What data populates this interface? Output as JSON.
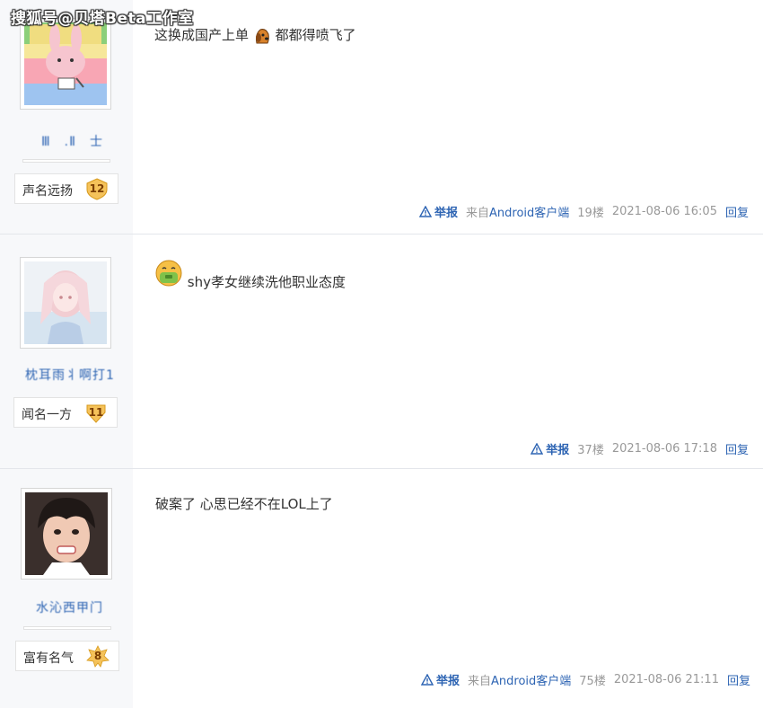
{
  "watermark": "搜狐号@贝塔Beta工作室",
  "posts": [
    {
      "username": "Ⅲ　.Ⅱ　士",
      "level_name": "声名远扬",
      "level_num": "12",
      "content_before": "这换成国产上单",
      "content_after": "都都得喷飞了",
      "report_label": "举报",
      "client_prefix": "来自",
      "client_name": "Android客户端",
      "floor": "19楼",
      "datetime": "2021-08-06 16:05",
      "reply_label": "回复"
    },
    {
      "username": "枕耳雨丬啊打1",
      "level_name": "闻名一方",
      "level_num": "11",
      "content_before": "",
      "content_after": "shy孝女继续洗他职业态度",
      "report_label": "举报",
      "floor": "37楼",
      "datetime": "2021-08-06 17:18",
      "reply_label": "回复"
    },
    {
      "username": "水沁西甲门",
      "level_name": "富有名气",
      "level_num": "8",
      "content_before": "",
      "content_after": "破案了 心思已经不在LOL上了",
      "report_label": "举报",
      "client_prefix": "来自",
      "client_name": "Android客户端",
      "floor": "75楼",
      "datetime": "2021-08-06 21:11",
      "reply_label": "回复"
    }
  ],
  "icons": {
    "report": "warning-triangle-icon",
    "emoji_post1": "dog-head-emoji",
    "emoji_post2": "vomit-face-emoji"
  },
  "colors": {
    "link": "#2d64b3",
    "meta": "#999999",
    "sidebar_bg": "#f7f8fa",
    "badge": "#f5c25a"
  }
}
